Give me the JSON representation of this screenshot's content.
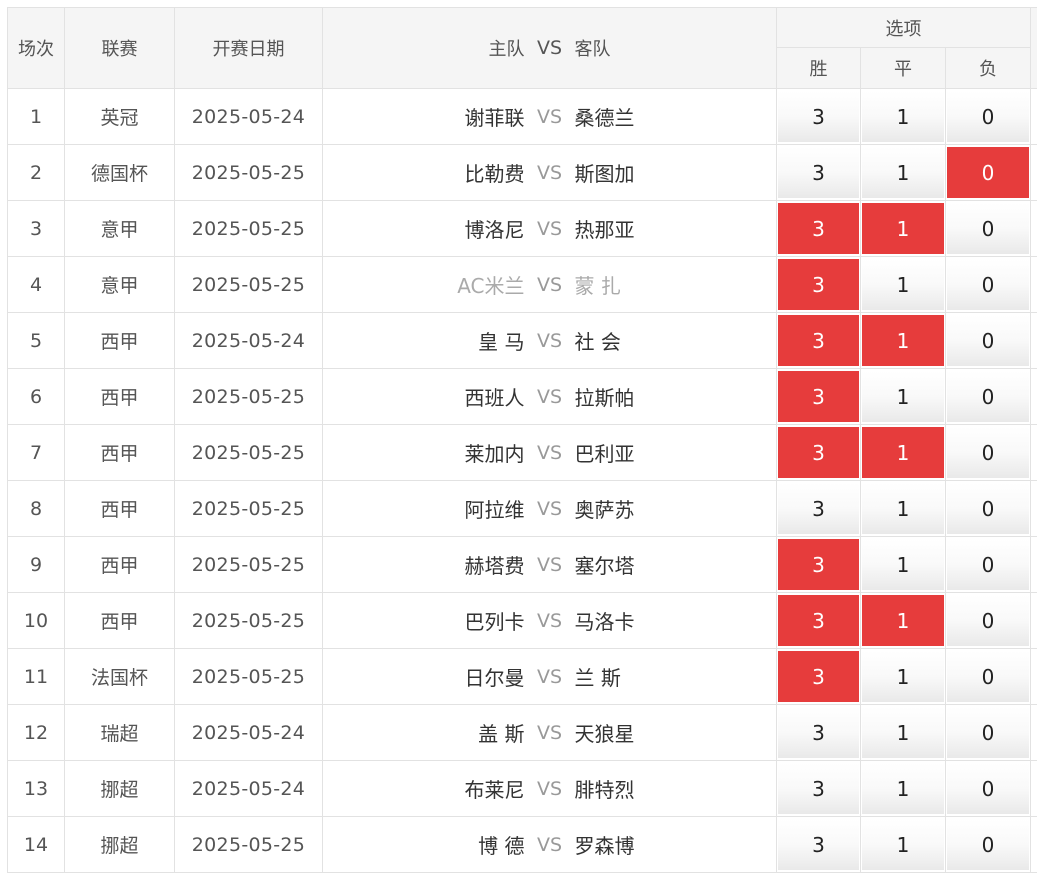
{
  "header": {
    "round": "场次",
    "league": "联赛",
    "date": "开赛日期",
    "home": "主队",
    "vs": "VS",
    "away": "客队",
    "options": "选项",
    "win": "胜",
    "draw": "平",
    "lose": "负"
  },
  "colors": {
    "selected": "#e63c3c"
  },
  "rows": [
    {
      "no": "1",
      "league": "英冠",
      "date": "2025-05-24",
      "home": "谢菲联",
      "vs": "VS",
      "away": "桑德兰",
      "w": "3",
      "d": "1",
      "l": "0",
      "sw": false,
      "sd": false,
      "sl": false,
      "muted": false
    },
    {
      "no": "2",
      "league": "德国杯",
      "date": "2025-05-25",
      "home": "比勒费",
      "vs": "VS",
      "away": "斯图加",
      "w": "3",
      "d": "1",
      "l": "0",
      "sw": false,
      "sd": false,
      "sl": true,
      "muted": false
    },
    {
      "no": "3",
      "league": "意甲",
      "date": "2025-05-25",
      "home": "博洛尼",
      "vs": "VS",
      "away": "热那亚",
      "w": "3",
      "d": "1",
      "l": "0",
      "sw": true,
      "sd": true,
      "sl": false,
      "muted": false
    },
    {
      "no": "4",
      "league": "意甲",
      "date": "2025-05-25",
      "home": "AC米兰",
      "vs": "VS",
      "away": "蒙 扎",
      "w": "3",
      "d": "1",
      "l": "0",
      "sw": true,
      "sd": false,
      "sl": false,
      "muted": true
    },
    {
      "no": "5",
      "league": "西甲",
      "date": "2025-05-24",
      "home": "皇 马",
      "vs": "VS",
      "away": "社 会",
      "w": "3",
      "d": "1",
      "l": "0",
      "sw": true,
      "sd": true,
      "sl": false,
      "muted": false
    },
    {
      "no": "6",
      "league": "西甲",
      "date": "2025-05-25",
      "home": "西班人",
      "vs": "VS",
      "away": "拉斯帕",
      "w": "3",
      "d": "1",
      "l": "0",
      "sw": true,
      "sd": false,
      "sl": false,
      "muted": false
    },
    {
      "no": "7",
      "league": "西甲",
      "date": "2025-05-25",
      "home": "莱加内",
      "vs": "VS",
      "away": "巴利亚",
      "w": "3",
      "d": "1",
      "l": "0",
      "sw": true,
      "sd": true,
      "sl": false,
      "muted": false
    },
    {
      "no": "8",
      "league": "西甲",
      "date": "2025-05-25",
      "home": "阿拉维",
      "vs": "VS",
      "away": "奥萨苏",
      "w": "3",
      "d": "1",
      "l": "0",
      "sw": false,
      "sd": false,
      "sl": false,
      "muted": false
    },
    {
      "no": "9",
      "league": "西甲",
      "date": "2025-05-25",
      "home": "赫塔费",
      "vs": "VS",
      "away": "塞尔塔",
      "w": "3",
      "d": "1",
      "l": "0",
      "sw": true,
      "sd": false,
      "sl": false,
      "muted": false
    },
    {
      "no": "10",
      "league": "西甲",
      "date": "2025-05-25",
      "home": "巴列卡",
      "vs": "VS",
      "away": "马洛卡",
      "w": "3",
      "d": "1",
      "l": "0",
      "sw": true,
      "sd": true,
      "sl": false,
      "muted": false
    },
    {
      "no": "11",
      "league": "法国杯",
      "date": "2025-05-25",
      "home": "日尔曼",
      "vs": "VS",
      "away": "兰 斯",
      "w": "3",
      "d": "1",
      "l": "0",
      "sw": true,
      "sd": false,
      "sl": false,
      "muted": false
    },
    {
      "no": "12",
      "league": "瑞超",
      "date": "2025-05-24",
      "home": "盖 斯",
      "vs": "VS",
      "away": "天狼星",
      "w": "3",
      "d": "1",
      "l": "0",
      "sw": false,
      "sd": false,
      "sl": false,
      "muted": false
    },
    {
      "no": "13",
      "league": "挪超",
      "date": "2025-05-24",
      "home": "布莱尼",
      "vs": "VS",
      "away": "腓特烈",
      "w": "3",
      "d": "1",
      "l": "0",
      "sw": false,
      "sd": false,
      "sl": false,
      "muted": false
    },
    {
      "no": "14",
      "league": "挪超",
      "date": "2025-05-25",
      "home": "博 德",
      "vs": "VS",
      "away": "罗森博",
      "w": "3",
      "d": "1",
      "l": "0",
      "sw": false,
      "sd": false,
      "sl": false,
      "muted": false
    }
  ]
}
